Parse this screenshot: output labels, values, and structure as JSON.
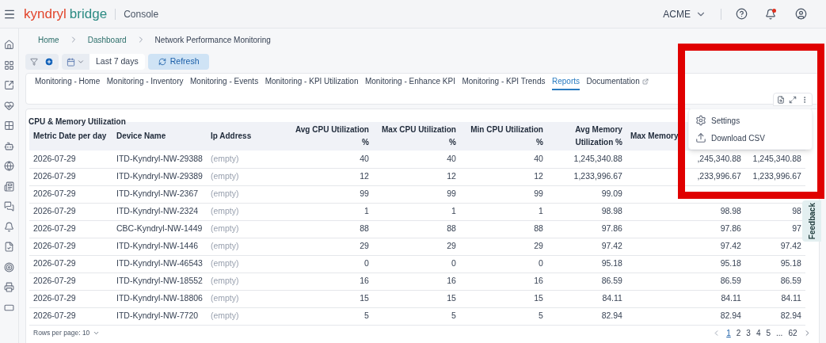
{
  "header": {
    "logo": {
      "part_1": "kyndryl",
      "part_2": "bridge"
    },
    "app_name": "Console",
    "account": "ACME"
  },
  "breadcrumb": [
    {
      "label": "Home",
      "link": true
    },
    {
      "label": "Dashboard",
      "link": true
    },
    {
      "label": "Network Performance Monitoring",
      "link": false
    }
  ],
  "toolbar": {
    "date_range": "Last 7 days",
    "refresh": "Refresh"
  },
  "tabs": [
    {
      "label": "Monitoring - Home",
      "selected": false
    },
    {
      "label": "Monitoring - Inventory",
      "selected": false
    },
    {
      "label": "Monitoring - Events",
      "selected": false
    },
    {
      "label": "Monitoring - KPI Utilization",
      "selected": false
    },
    {
      "label": "Monitoring - Enhance KPI",
      "selected": false
    },
    {
      "label": "Monitoring - KPI Trends",
      "selected": false
    },
    {
      "label": "Reports",
      "selected": true
    },
    {
      "label": "Documentation",
      "selected": false,
      "external": true
    }
  ],
  "table": {
    "title": "CPU & Memory Utilization",
    "columns": [
      "Metric Date per day",
      "Device Name",
      "Ip Address",
      "Avg CPU Utilization %",
      "Max CPU Utilization %",
      "Min CPU Utilization %",
      "Avg Memory Utilization %",
      "Max Memory"
    ],
    "rows": [
      [
        "2026-07-29",
        "ITD-Kyndryl-NW-29388",
        "(empty)",
        "40",
        "40",
        "40",
        "1,245,340.88",
        ",245,340.88",
        "1,245,340.88"
      ],
      [
        "2026-07-29",
        "ITD-Kyndryl-NW-29389",
        "(empty)",
        "12",
        "12",
        "12",
        "1,233,996.67",
        ",233,996.67",
        "1,233,996.67"
      ],
      [
        "2026-07-29",
        "ITD-Kyndryl-NW-2367",
        "(empty)",
        "99",
        "99",
        "99",
        "99.09"
      ],
      [
        "2026-07-29",
        "ITD-Kyndryl-NW-2324",
        "(empty)",
        "1",
        "1",
        "1",
        "98.98",
        "98.98",
        "98"
      ],
      [
        "2026-07-29",
        "CBC-Kyndryl-NW-1449",
        "(empty)",
        "88",
        "88",
        "88",
        "97.86",
        "97.86",
        "97"
      ],
      [
        "2026-07-29",
        "ITD-Kyndryl-NW-1446",
        "(empty)",
        "29",
        "29",
        "29",
        "97.42",
        "97.42",
        "97.42"
      ],
      [
        "2026-07-29",
        "ITD-Kyndryl-NW-46543",
        "(empty)",
        "0",
        "0",
        "0",
        "95.18",
        "95.18",
        "95.18"
      ],
      [
        "2026-07-29",
        "ITD-Kyndryl-NW-18552",
        "(empty)",
        "16",
        "16",
        "16",
        "86.59",
        "86.59",
        "86.59"
      ],
      [
        "2026-07-29",
        "ITD-Kyndryl-NW-18806",
        "(empty)",
        "15",
        "15",
        "15",
        "84.11",
        "84.11",
        "84.11"
      ],
      [
        "2026-07-29",
        "ITD-Kyndryl-NW-7720",
        "(empty)",
        "5",
        "5",
        "5",
        "82.94",
        "82.94",
        "82.94"
      ]
    ],
    "rows_per_page": "Rows per page: 10",
    "pages": [
      {
        "label": "1",
        "selected": true
      },
      {
        "label": "2",
        "selected": false
      },
      {
        "label": "3",
        "selected": false
      },
      {
        "label": "4",
        "selected": false
      },
      {
        "label": "5",
        "selected": false
      },
      {
        "label": "...",
        "selected": false
      },
      {
        "label": "62",
        "selected": false
      }
    ]
  },
  "menu": [
    {
      "kind": "settings",
      "label": "Settings"
    },
    {
      "kind": "download",
      "label": "Download CSV"
    }
  ],
  "feedback": "Feedback"
}
